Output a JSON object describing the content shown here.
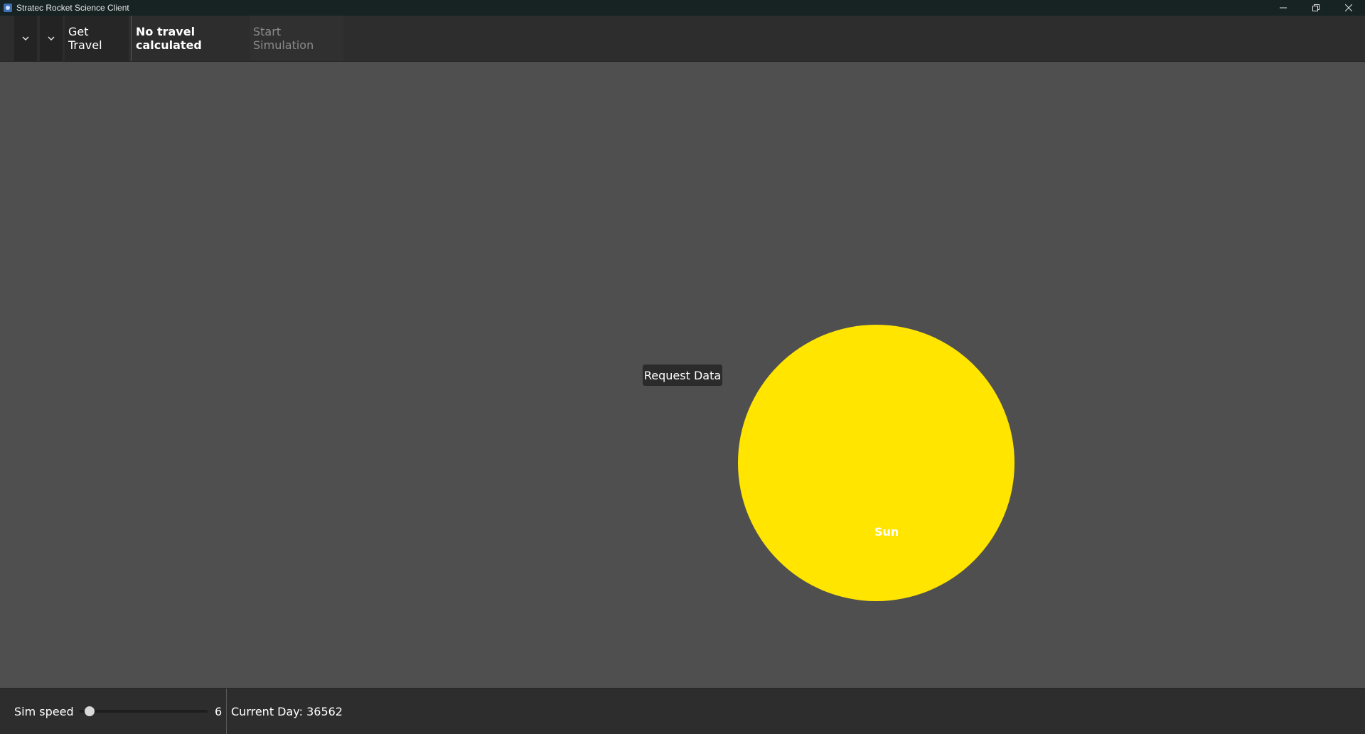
{
  "window": {
    "title": "Stratec Rocket Science Client",
    "controls": [
      "minimize-icon",
      "restore-icon",
      "close-icon"
    ]
  },
  "toolbar": {
    "dropdown_1_icon": "chevron-down-icon",
    "dropdown_2_icon": "chevron-down-icon",
    "get_travel_label": "Get Travel",
    "travel_status": "No travel calculated",
    "start_simulation_label": "Start Simulation",
    "start_simulation_enabled": false
  },
  "canvas": {
    "request_data_label": "Request Data",
    "bodies": [
      {
        "name": "Sun",
        "color": "#ffe500"
      }
    ]
  },
  "statusbar": {
    "sim_speed_label": "Sim speed",
    "sim_speed_value": "6",
    "sim_speed_fraction": 0.04,
    "current_day_text": "Current Day: 36562"
  },
  "colors": {
    "background": "#4f4f4f",
    "panel": "#2d2d2d",
    "titlebar": "#172322",
    "sun": "#ffe500"
  }
}
